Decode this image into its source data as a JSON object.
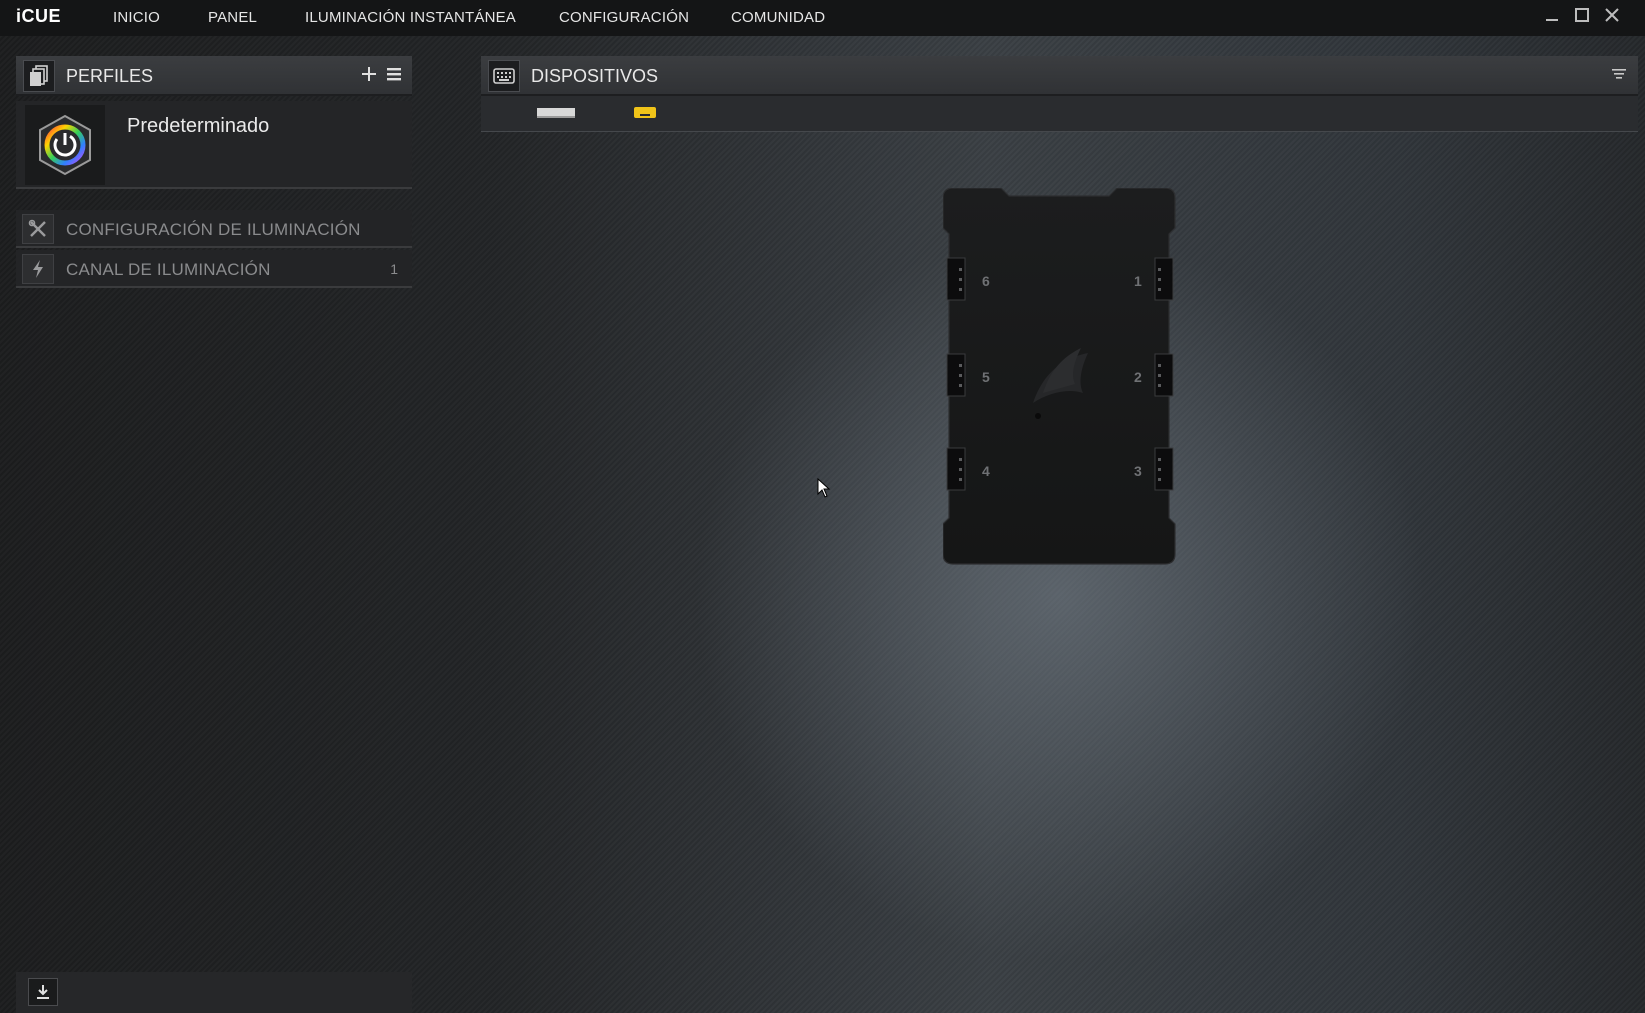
{
  "app": {
    "brand": "iCUE"
  },
  "nav": [
    {
      "id": "inicio",
      "label": "INICIO"
    },
    {
      "id": "panel",
      "label": "PANEL"
    },
    {
      "id": "iluminacion",
      "label": "ILUMINACIÓN INSTANTÁNEA"
    },
    {
      "id": "configuracion",
      "label": "CONFIGURACIÓN"
    },
    {
      "id": "comunidad",
      "label": "COMUNIDAD"
    }
  ],
  "profiles": {
    "title": "PERFILES",
    "active_profile": "Predeterminado"
  },
  "menu": [
    {
      "label": "CONFIGURACIÓN DE ILUMINACIÓN",
      "count": ""
    },
    {
      "label": "CANAL DE ILUMINACIÓN",
      "count": "1"
    }
  ],
  "devices": {
    "title": "DISPOSITIVOS",
    "tabs": [
      {
        "name": "memory-device",
        "selected": false
      },
      {
        "name": "lighting-node-device",
        "selected": true
      }
    ]
  },
  "hub": {
    "ports": [
      "6",
      "1",
      "5",
      "2",
      "4",
      "3"
    ]
  },
  "colors": {
    "accent_yellow": "#f0c419",
    "topbar": "#141516"
  }
}
